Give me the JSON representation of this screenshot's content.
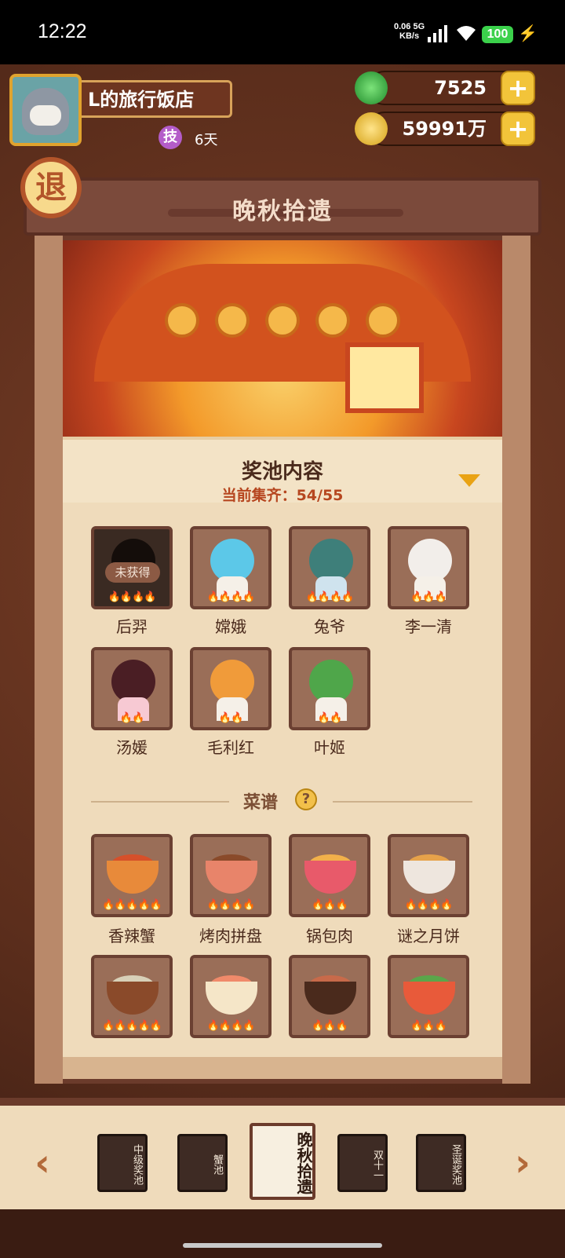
{
  "status_bar": {
    "time": "12:22",
    "net_speed_value": "0.06 5G",
    "net_speed_unit": "KB/s",
    "battery": "100"
  },
  "player": {
    "restaurant_name": "L的旅行饭店",
    "skill_label": "技",
    "days": "6天"
  },
  "currencies": {
    "jade": "7525",
    "coins": "59991万"
  },
  "header": {
    "exit_label": "退",
    "title": "晚秋拾遗"
  },
  "pool": {
    "title": "奖池内容",
    "progress": "当前集齐：54/55"
  },
  "characters": [
    {
      "name": "后羿",
      "stars": "🔥🔥🔥🔥",
      "locked": true,
      "lock_label": "未获得"
    },
    {
      "name": "嫦娥",
      "stars": "🔥🔥🔥🔥"
    },
    {
      "name": "兔爷",
      "stars": "🔥🔥🔥🔥"
    },
    {
      "name": "李一清",
      "stars": "🔥🔥🔥"
    },
    {
      "name": "汤媛",
      "stars": "🔥🔥"
    },
    {
      "name": "毛利红",
      "stars": "🔥🔥"
    },
    {
      "name": "叶姬",
      "stars": "🔥🔥"
    }
  ],
  "recipes_section": {
    "title": "菜谱",
    "help_label": "?"
  },
  "recipes": [
    {
      "name": "香辣蟹",
      "stars": "🔥🔥🔥🔥🔥"
    },
    {
      "name": "烤肉拼盘",
      "stars": "🔥🔥🔥🔥"
    },
    {
      "name": "锅包肉",
      "stars": "🔥🔥🔥"
    },
    {
      "name": "谜之月饼",
      "stars": "🔥🔥🔥🔥"
    },
    {
      "name": "",
      "stars": "🔥🔥🔥🔥🔥"
    },
    {
      "name": "",
      "stars": "🔥🔥🔥🔥"
    },
    {
      "name": "",
      "stars": "🔥🔥🔥"
    },
    {
      "name": "",
      "stars": "🔥🔥🔥"
    }
  ],
  "pool_tabs": [
    {
      "label": "中级奖池",
      "active": false
    },
    {
      "label": "蟹池",
      "active": false
    },
    {
      "label": "晚秋拾遗",
      "active": true
    },
    {
      "label": "双十一",
      "active": false
    },
    {
      "label": "圣诞奖池",
      "active": false
    }
  ],
  "nav": {
    "prev": "‹",
    "next": "›"
  },
  "colors": {
    "accent_orange": "#e9a314",
    "progress_red": "#b6461f",
    "paper": "#efdbbb",
    "wood": "#6b3b2b"
  }
}
